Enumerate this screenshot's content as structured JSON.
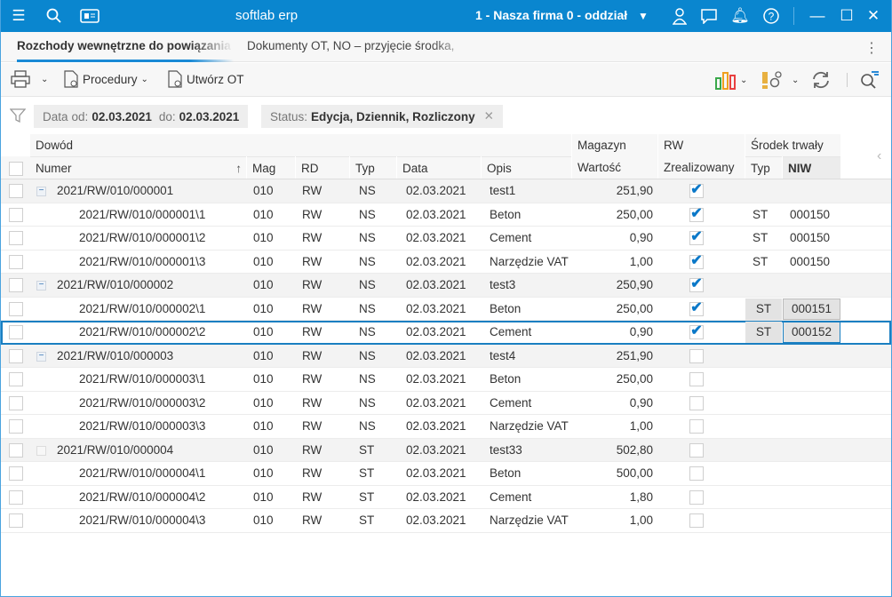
{
  "titlebar": {
    "app_title": "softlab erp",
    "company": "1 - Nasza firma 0 - oddział",
    "icons": [
      "menu-icon",
      "search-icon",
      "news-icon",
      "chevron-down-icon",
      "user-icon",
      "chat-icon",
      "bell-icon",
      "help-icon",
      "minimize-icon",
      "maximize-icon",
      "close-icon"
    ]
  },
  "tabs": [
    {
      "label": "Rozchody wewnętrzne do powiązania z",
      "active": true
    },
    {
      "label": "Dokumenty OT, NO – przyjęcie środka, ",
      "active": false
    }
  ],
  "toolbar": {
    "procedury": "Procedury",
    "utworz_ot": "Utwórz OT"
  },
  "filters": {
    "date_label": "Data",
    "from_label": "od:",
    "from": "02.03.2021",
    "to_label": "do:",
    "to": "02.03.2021",
    "status_label": "Status:",
    "status_value": "Edycja, Dziennik, Rozliczony"
  },
  "columns": {
    "group_dowod": "Dowód",
    "group_magazyn": "Magazyn",
    "group_rw": "RW",
    "group_srodek": "Środek trwały",
    "numer": "Numer",
    "mag": "Mag",
    "rd": "RD",
    "typ": "Typ",
    "data": "Data",
    "opis": "Opis",
    "wartosc": "Wartość",
    "zrealizowany": "Zrealizowany",
    "st_typ": "Typ",
    "niw": "NIW"
  },
  "colors": {
    "accent": "#0a86cf",
    "check": "#0a78c8"
  },
  "rows": [
    {
      "group": true,
      "expanded": true,
      "numer": "2021/RW/010/000001",
      "mag": "010",
      "rd": "RW",
      "typ": "NS",
      "data": "02.03.2021",
      "opis": "test1",
      "wartosc": "251,90",
      "zreal": true,
      "st_typ": "",
      "niw": ""
    },
    {
      "group": false,
      "numer": "2021/RW/010/000001\\1",
      "mag": "010",
      "rd": "RW",
      "typ": "NS",
      "data": "02.03.2021",
      "opis": "Beton",
      "wartosc": "250,00",
      "zreal": true,
      "st_typ": "ST",
      "niw": "000150"
    },
    {
      "group": false,
      "numer": "2021/RW/010/000001\\2",
      "mag": "010",
      "rd": "RW",
      "typ": "NS",
      "data": "02.03.2021",
      "opis": "Cement",
      "wartosc": "0,90",
      "zreal": true,
      "st_typ": "ST",
      "niw": "000150"
    },
    {
      "group": false,
      "numer": "2021/RW/010/000001\\3",
      "mag": "010",
      "rd": "RW",
      "typ": "NS",
      "data": "02.03.2021",
      "opis": "Narzędzie VAT",
      "wartosc": "1,00",
      "zreal": true,
      "st_typ": "ST",
      "niw": "000150"
    },
    {
      "group": true,
      "expanded": true,
      "numer": "2021/RW/010/000002",
      "mag": "010",
      "rd": "RW",
      "typ": "NS",
      "data": "02.03.2021",
      "opis": "test3",
      "wartosc": "250,90",
      "zreal": true,
      "st_typ": "",
      "niw": ""
    },
    {
      "group": false,
      "editable": true,
      "numer": "2021/RW/010/000002\\1",
      "mag": "010",
      "rd": "RW",
      "typ": "NS",
      "data": "02.03.2021",
      "opis": "Beton",
      "wartosc": "250,00",
      "zreal": true,
      "st_typ": "ST",
      "niw": "000151"
    },
    {
      "group": false,
      "editable": true,
      "selected": true,
      "numer": "2021/RW/010/000002\\2",
      "mag": "010",
      "rd": "RW",
      "typ": "NS",
      "data": "02.03.2021",
      "opis": "Cement",
      "wartosc": "0,90",
      "zreal": true,
      "st_typ": "ST",
      "niw": "000152"
    },
    {
      "group": true,
      "expanded": true,
      "numer": "2021/RW/010/000003",
      "mag": "010",
      "rd": "RW",
      "typ": "NS",
      "data": "02.03.2021",
      "opis": "test4",
      "wartosc": "251,90",
      "zreal": false,
      "st_typ": "",
      "niw": ""
    },
    {
      "group": false,
      "numer": "2021/RW/010/000003\\1",
      "mag": "010",
      "rd": "RW",
      "typ": "NS",
      "data": "02.03.2021",
      "opis": "Beton",
      "wartosc": "250,00",
      "zreal": false,
      "st_typ": "",
      "niw": ""
    },
    {
      "group": false,
      "numer": "2021/RW/010/000003\\2",
      "mag": "010",
      "rd": "RW",
      "typ": "NS",
      "data": "02.03.2021",
      "opis": "Cement",
      "wartosc": "0,90",
      "zreal": false,
      "st_typ": "",
      "niw": ""
    },
    {
      "group": false,
      "numer": "2021/RW/010/000003\\3",
      "mag": "010",
      "rd": "RW",
      "typ": "NS",
      "data": "02.03.2021",
      "opis": "Narzędzie VAT",
      "wartosc": "1,00",
      "zreal": false,
      "st_typ": "",
      "niw": ""
    },
    {
      "group": true,
      "expanded": false,
      "numer": "2021/RW/010/000004",
      "mag": "010",
      "rd": "RW",
      "typ": "ST",
      "data": "02.03.2021",
      "opis": "test33",
      "wartosc": "502,80",
      "zreal": false,
      "st_typ": "",
      "niw": ""
    },
    {
      "group": false,
      "numer": "2021/RW/010/000004\\1",
      "mag": "010",
      "rd": "RW",
      "typ": "ST",
      "data": "02.03.2021",
      "opis": "Beton",
      "wartosc": "500,00",
      "zreal": false,
      "st_typ": "",
      "niw": ""
    },
    {
      "group": false,
      "numer": "2021/RW/010/000004\\2",
      "mag": "010",
      "rd": "RW",
      "typ": "ST",
      "data": "02.03.2021",
      "opis": "Cement",
      "wartosc": "1,80",
      "zreal": false,
      "st_typ": "",
      "niw": ""
    },
    {
      "group": false,
      "numer": "2021/RW/010/000004\\3",
      "mag": "010",
      "rd": "RW",
      "typ": "ST",
      "data": "02.03.2021",
      "opis": "Narzędzie VAT",
      "wartosc": "1,00",
      "zreal": false,
      "st_typ": "",
      "niw": ""
    }
  ]
}
